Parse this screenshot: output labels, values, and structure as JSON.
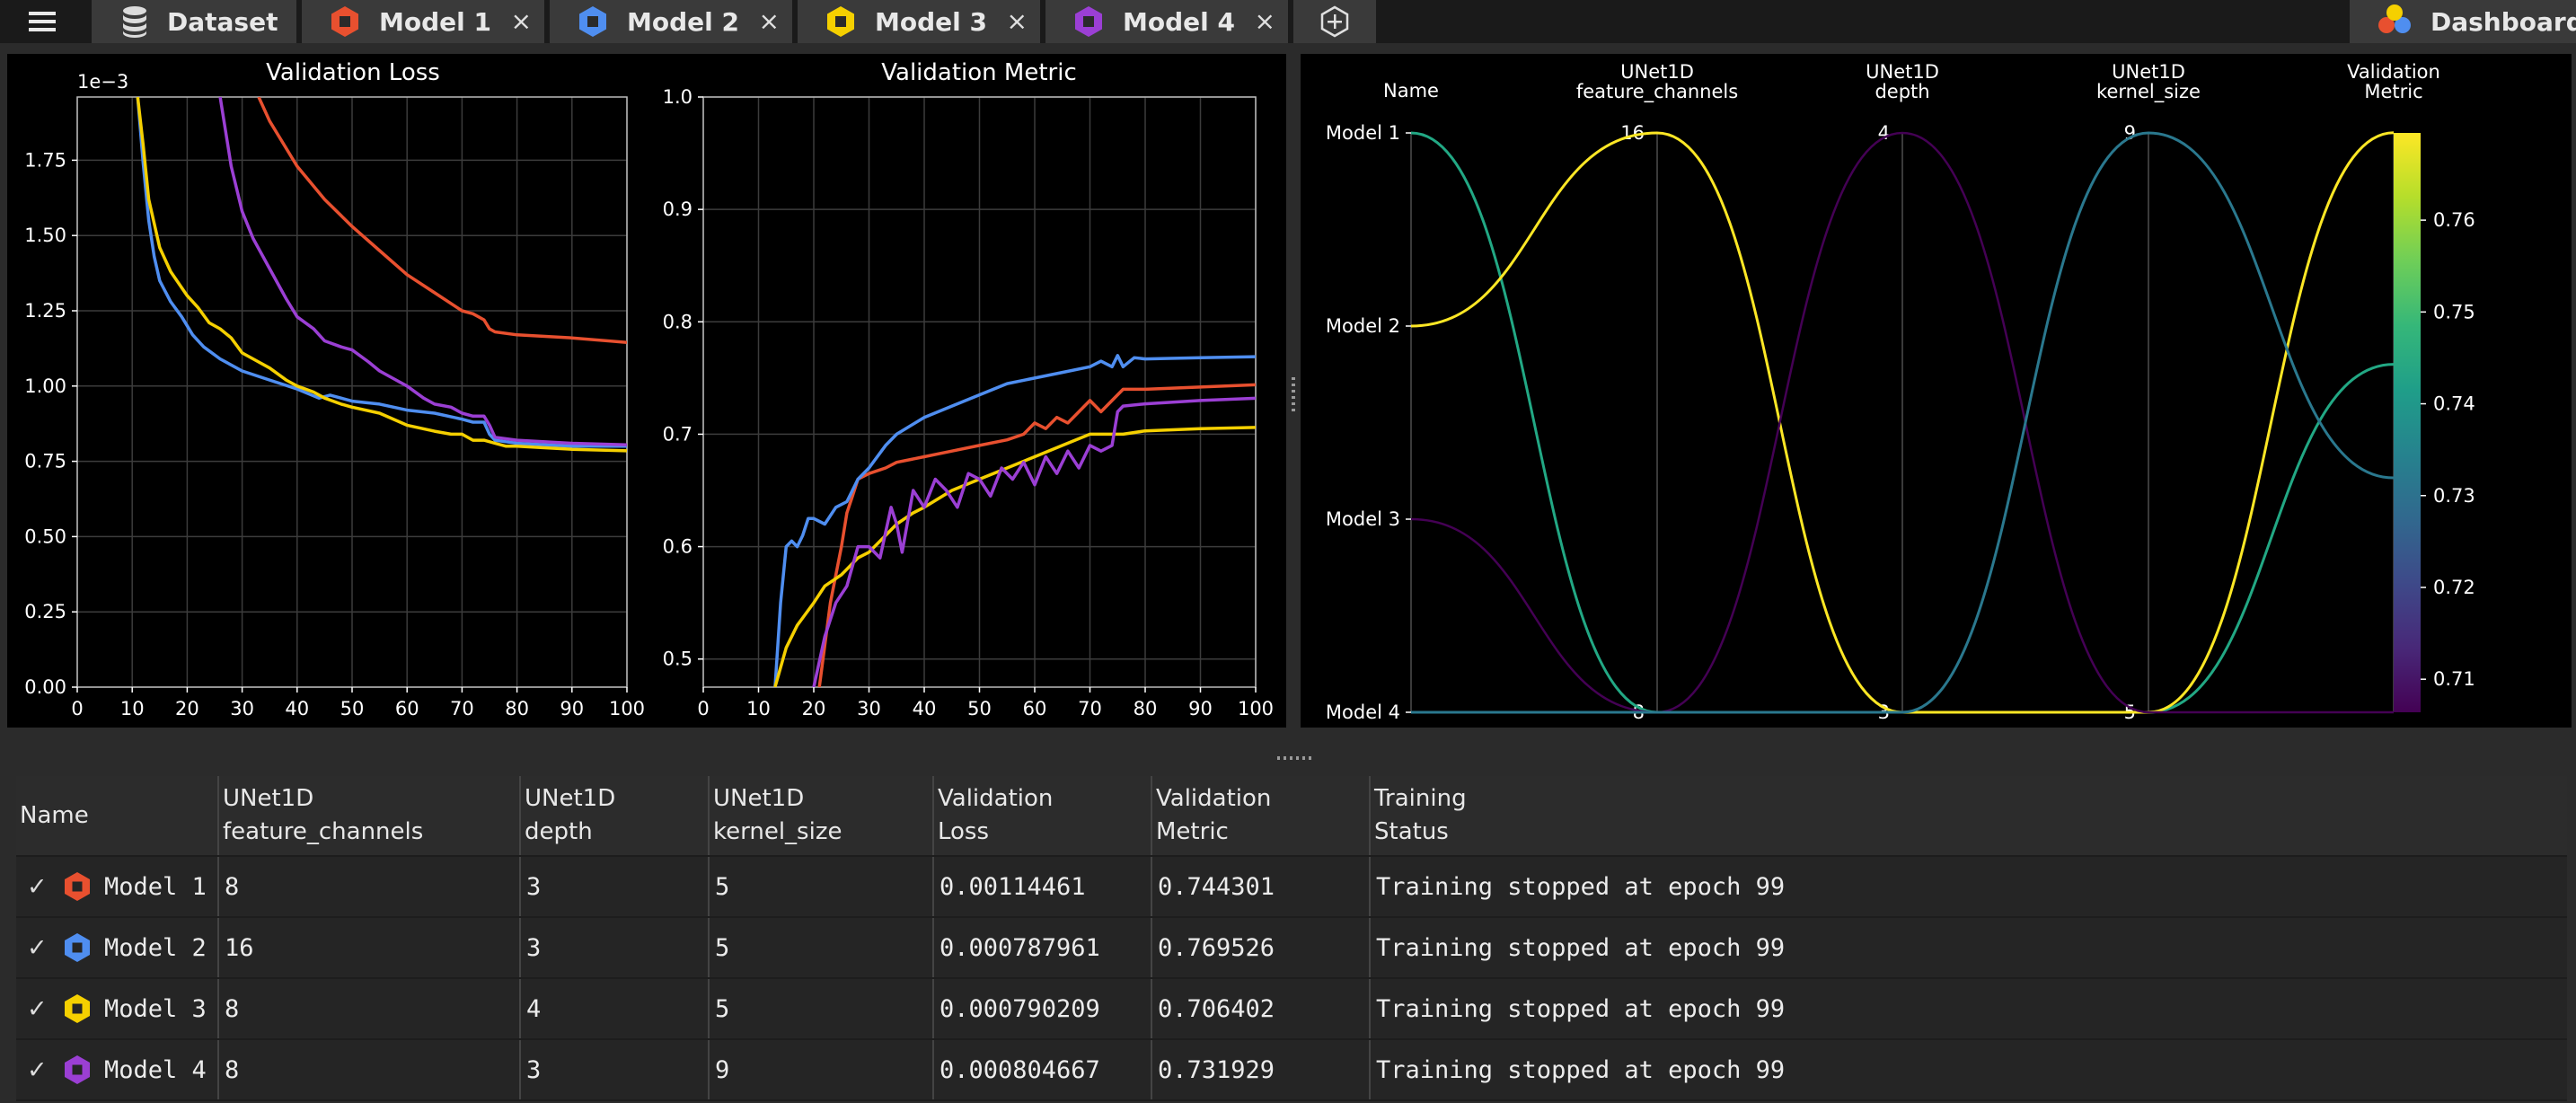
{
  "tabbar": {
    "dataset_label": "Dataset",
    "tabs": [
      {
        "label": "Model 1",
        "color": "#e8502f"
      },
      {
        "label": "Model 2",
        "color": "#4f8ef0"
      },
      {
        "label": "Model 3",
        "color": "#f5d000"
      },
      {
        "label": "Model 4",
        "color": "#9b3fd4"
      }
    ],
    "close_glyph": "×",
    "dashboard_label": "Dashboard",
    "icons": [
      "menu-icon",
      "database-icon",
      "hexagon-icon",
      "add-tab-icon",
      "dashboard-icon"
    ]
  },
  "chart_data": [
    {
      "type": "line",
      "title": "Validation Loss",
      "scale_label": "1e−3",
      "xlim": [
        0,
        100
      ],
      "ylim": [
        0,
        1.96
      ],
      "x_ticks": [
        0,
        10,
        20,
        30,
        40,
        50,
        60,
        70,
        80,
        90,
        100
      ],
      "y_ticks": [
        0.0,
        0.25,
        0.5,
        0.75,
        1.0,
        1.25,
        1.5,
        1.75
      ],
      "grid": true,
      "series": [
        {
          "name": "Model 1",
          "color": "#e8502f",
          "x": [
            33,
            35,
            40,
            45,
            50,
            55,
            60,
            65,
            70,
            72,
            74,
            75,
            76,
            80,
            90,
            100
          ],
          "y": [
            1.96,
            1.88,
            1.73,
            1.62,
            1.53,
            1.45,
            1.37,
            1.31,
            1.25,
            1.24,
            1.22,
            1.19,
            1.18,
            1.17,
            1.16,
            1.145
          ]
        },
        {
          "name": "Model 2",
          "color": "#4f8ef0",
          "x": [
            11,
            12,
            13,
            14,
            15,
            17,
            19,
            21,
            23,
            26,
            30,
            35,
            40,
            44,
            46,
            50,
            55,
            60,
            65,
            70,
            72,
            74,
            75,
            76,
            78,
            80,
            90,
            100
          ],
          "y": [
            1.96,
            1.74,
            1.55,
            1.43,
            1.35,
            1.28,
            1.23,
            1.17,
            1.13,
            1.09,
            1.05,
            1.02,
            0.99,
            0.96,
            0.97,
            0.95,
            0.94,
            0.92,
            0.91,
            0.89,
            0.88,
            0.88,
            0.84,
            0.82,
            0.815,
            0.81,
            0.8,
            0.8
          ]
        },
        {
          "name": "Model 3",
          "color": "#f5d000",
          "x": [
            11,
            12,
            13,
            15,
            17,
            20,
            22,
            24,
            26,
            28,
            30,
            33,
            35,
            38,
            40,
            43,
            45,
            48,
            50,
            55,
            60,
            65,
            68,
            70,
            72,
            74,
            76,
            78,
            80,
            85,
            90,
            100
          ],
          "y": [
            1.96,
            1.8,
            1.62,
            1.46,
            1.38,
            1.3,
            1.26,
            1.21,
            1.19,
            1.16,
            1.11,
            1.08,
            1.06,
            1.02,
            1.0,
            0.98,
            0.96,
            0.94,
            0.93,
            0.91,
            0.87,
            0.85,
            0.84,
            0.84,
            0.82,
            0.82,
            0.81,
            0.8,
            0.8,
            0.795,
            0.79,
            0.785
          ]
        },
        {
          "name": "Model 4",
          "color": "#9b3fd4",
          "x": [
            26,
            28,
            30,
            32,
            35,
            38,
            40,
            43,
            45,
            48,
            50,
            53,
            55,
            58,
            60,
            63,
            65,
            68,
            70,
            72,
            74,
            75,
            76,
            80,
            90,
            100
          ],
          "y": [
            1.96,
            1.73,
            1.58,
            1.49,
            1.39,
            1.29,
            1.23,
            1.19,
            1.15,
            1.13,
            1.12,
            1.08,
            1.05,
            1.02,
            1.0,
            0.96,
            0.94,
            0.93,
            0.91,
            0.9,
            0.9,
            0.87,
            0.83,
            0.82,
            0.81,
            0.805
          ]
        }
      ]
    },
    {
      "type": "line",
      "title": "Validation Metric",
      "xlim": [
        0,
        100
      ],
      "ylim": [
        0.475,
        1.0
      ],
      "x_ticks": [
        0,
        10,
        20,
        30,
        40,
        50,
        60,
        70,
        80,
        90,
        100
      ],
      "y_ticks": [
        0.5,
        0.6,
        0.7,
        0.8,
        0.9,
        1.0
      ],
      "grid": true,
      "series": [
        {
          "name": "Model 1",
          "color": "#e8502f",
          "x": [
            21,
            23,
            25,
            26,
            27,
            28,
            30,
            33,
            35,
            40,
            45,
            50,
            55,
            58,
            60,
            62,
            64,
            66,
            68,
            70,
            72,
            74,
            76,
            80,
            90,
            100
          ],
          "y": [
            0.475,
            0.55,
            0.6,
            0.63,
            0.645,
            0.66,
            0.665,
            0.67,
            0.675,
            0.68,
            0.685,
            0.69,
            0.695,
            0.7,
            0.71,
            0.705,
            0.715,
            0.71,
            0.72,
            0.73,
            0.72,
            0.73,
            0.74,
            0.74,
            0.742,
            0.744
          ]
        },
        {
          "name": "Model 2",
          "color": "#4f8ef0",
          "x": [
            13,
            14,
            15,
            16,
            17,
            18,
            19,
            20,
            22,
            24,
            26,
            28,
            30,
            33,
            35,
            40,
            45,
            50,
            55,
            60,
            65,
            70,
            72,
            74,
            75,
            76,
            78,
            80,
            90,
            100
          ],
          "y": [
            0.475,
            0.55,
            0.6,
            0.605,
            0.6,
            0.61,
            0.625,
            0.625,
            0.62,
            0.635,
            0.64,
            0.66,
            0.67,
            0.69,
            0.7,
            0.715,
            0.725,
            0.735,
            0.745,
            0.75,
            0.755,
            0.76,
            0.765,
            0.76,
            0.77,
            0.76,
            0.768,
            0.767,
            0.768,
            0.769
          ]
        },
        {
          "name": "Model 3",
          "color": "#f5d000",
          "x": [
            13,
            15,
            17,
            20,
            22,
            25,
            28,
            30,
            33,
            35,
            38,
            40,
            45,
            50,
            55,
            60,
            65,
            70,
            75,
            76,
            80,
            90,
            100
          ],
          "y": [
            0.475,
            0.51,
            0.53,
            0.55,
            0.565,
            0.575,
            0.59,
            0.595,
            0.61,
            0.62,
            0.63,
            0.635,
            0.65,
            0.66,
            0.67,
            0.68,
            0.69,
            0.7,
            0.7,
            0.7,
            0.703,
            0.705,
            0.706
          ]
        },
        {
          "name": "Model 4",
          "color": "#9b3fd4",
          "x": [
            20,
            22,
            24,
            26,
            28,
            30,
            32,
            34,
            35,
            36,
            38,
            40,
            42,
            44,
            46,
            48,
            50,
            52,
            54,
            56,
            58,
            60,
            62,
            64,
            66,
            68,
            70,
            72,
            74,
            75,
            76,
            80,
            90,
            100
          ],
          "y": [
            0.475,
            0.52,
            0.55,
            0.565,
            0.6,
            0.6,
            0.59,
            0.635,
            0.62,
            0.595,
            0.65,
            0.635,
            0.66,
            0.65,
            0.635,
            0.665,
            0.66,
            0.645,
            0.67,
            0.66,
            0.675,
            0.655,
            0.68,
            0.665,
            0.685,
            0.67,
            0.69,
            0.685,
            0.69,
            0.72,
            0.725,
            0.727,
            0.73,
            0.732
          ]
        }
      ]
    },
    {
      "type": "parallel",
      "axes": [
        {
          "label": "Name",
          "ticks": [
            "Model 1",
            "Model 2",
            "Model 3",
            "Model 4"
          ]
        },
        {
          "label": "UNet1D\nfeature_channels",
          "max": "16",
          "min": "8"
        },
        {
          "label": "UNet1D\ndepth",
          "max": "4",
          "min": "3"
        },
        {
          "label": "UNet1D\nkernel_size",
          "max": "9",
          "min": "5"
        },
        {
          "label": "Validation\nMetric"
        }
      ],
      "colorbar": {
        "ticks": [
          "0.76",
          "0.75",
          "0.74",
          "0.73",
          "0.72",
          "0.71"
        ],
        "range": [
          0.7064,
          0.7695
        ]
      },
      "lines": [
        {
          "name": "Model 1",
          "feature_channels": 8,
          "depth": 3,
          "kernel_size": 5,
          "metric": 0.744301,
          "color": "#22a884"
        },
        {
          "name": "Model 2",
          "feature_channels": 16,
          "depth": 3,
          "kernel_size": 5,
          "metric": 0.769526,
          "color": "#fde725"
        },
        {
          "name": "Model 3",
          "feature_channels": 8,
          "depth": 4,
          "kernel_size": 5,
          "metric": 0.706402,
          "color": "#440154"
        },
        {
          "name": "Model 4",
          "feature_channels": 8,
          "depth": 3,
          "kernel_size": 9,
          "metric": 0.731929,
          "color": "#2a788e"
        }
      ]
    }
  ],
  "table": {
    "headers": [
      [
        "Name"
      ],
      [
        "UNet1D",
        "feature_channels"
      ],
      [
        "UNet1D",
        "depth"
      ],
      [
        "UNet1D",
        "kernel_size"
      ],
      [
        "Validation",
        "Loss"
      ],
      [
        "Validation",
        "Metric"
      ],
      [
        "Training",
        "Status"
      ]
    ],
    "check_glyph": "✓",
    "rows": [
      {
        "name": "Model 1",
        "color": "#e8502f",
        "feature_channels": "8",
        "depth": "3",
        "kernel_size": "5",
        "loss": "0.00114461",
        "metric": "0.744301",
        "status": "Training stopped at epoch 99"
      },
      {
        "name": "Model 2",
        "color": "#4f8ef0",
        "feature_channels": "16",
        "depth": "3",
        "kernel_size": "5",
        "loss": "0.000787961",
        "metric": "0.769526",
        "status": "Training stopped at epoch 99"
      },
      {
        "name": "Model 3",
        "color": "#f5d000",
        "feature_channels": "8",
        "depth": "4",
        "kernel_size": "5",
        "loss": "0.000790209",
        "metric": "0.706402",
        "status": "Training stopped at epoch 99"
      },
      {
        "name": "Model 4",
        "color": "#9b3fd4",
        "feature_channels": "8",
        "depth": "3",
        "kernel_size": "9",
        "loss": "0.000804667",
        "metric": "0.731929",
        "status": "Training stopped at epoch 99"
      }
    ]
  }
}
